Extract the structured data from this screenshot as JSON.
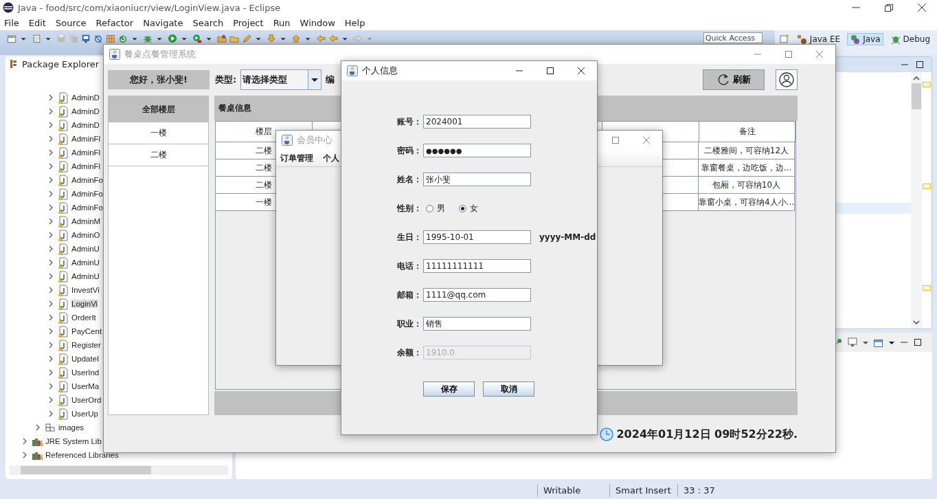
{
  "ide": {
    "title": "Java - food/src/com/xiaoniucr/view/LoginView.java - Eclipse",
    "menu": [
      "File",
      "Edit",
      "Source",
      "Refactor",
      "Navigate",
      "Search",
      "Project",
      "Run",
      "Window",
      "Help"
    ],
    "quick_access": {
      "placeholder": "Quick Access"
    },
    "perspectives": [
      {
        "label": "Java EE",
        "selected": false
      },
      {
        "label": "Java",
        "selected": true
      },
      {
        "label": "Debug",
        "selected": false
      }
    ],
    "package_explorer": {
      "title": "Package Explorer",
      "tree": [
        {
          "kind": "group",
          "children": [
            {
              "kind": "group",
              "children": [
                {
                  "label": "AdminD",
                  "kind": "file",
                  "expanded": false,
                  "selected": false
                },
                {
                  "label": "AdminD",
                  "kind": "file",
                  "expanded": false,
                  "selected": false
                },
                {
                  "label": "AdminD",
                  "kind": "file",
                  "expanded": false,
                  "selected": false
                },
                {
                  "label": "AdminFl",
                  "kind": "file",
                  "expanded": false,
                  "selected": false
                },
                {
                  "label": "AdminFl",
                  "kind": "file",
                  "expanded": false,
                  "selected": false
                },
                {
                  "label": "AdminFl",
                  "kind": "file",
                  "expanded": false,
                  "selected": false
                },
                {
                  "label": "AdminFo",
                  "kind": "file",
                  "expanded": false,
                  "selected": false
                },
                {
                  "label": "AdminFo",
                  "kind": "file",
                  "expanded": false,
                  "selected": false
                },
                {
                  "label": "AdminFo",
                  "kind": "file",
                  "expanded": false,
                  "selected": false
                },
                {
                  "label": "AdminM",
                  "kind": "file",
                  "expanded": false,
                  "selected": false
                },
                {
                  "label": "AdminO",
                  "kind": "file",
                  "expanded": false,
                  "selected": false
                },
                {
                  "label": "AdminU",
                  "kind": "file",
                  "expanded": false,
                  "selected": false
                },
                {
                  "label": "AdminU",
                  "kind": "file",
                  "expanded": false,
                  "selected": false
                },
                {
                  "label": "AdminU",
                  "kind": "file",
                  "expanded": false,
                  "selected": false
                },
                {
                  "label": "InvestVi",
                  "kind": "file",
                  "expanded": false,
                  "selected": false
                },
                {
                  "label": "LoginVi",
                  "kind": "file",
                  "expanded": false,
                  "selected": true
                },
                {
                  "label": "OrderIt",
                  "kind": "file",
                  "expanded": false,
                  "selected": false
                },
                {
                  "label": "PayCent",
                  "kind": "file",
                  "expanded": false,
                  "selected": false
                },
                {
                  "label": "Register",
                  "kind": "file",
                  "expanded": false,
                  "selected": false
                },
                {
                  "label": "UpdateI",
                  "kind": "file",
                  "expanded": false,
                  "selected": false
                },
                {
                  "label": "UserInd",
                  "kind": "file",
                  "expanded": false,
                  "selected": false
                },
                {
                  "label": "UserMa",
                  "kind": "file",
                  "expanded": false,
                  "selected": false
                },
                {
                  "label": "UserOrd",
                  "kind": "file",
                  "expanded": false,
                  "selected": false
                },
                {
                  "label": "UserUp",
                  "kind": "file",
                  "expanded": false,
                  "selected": false
                }
              ]
            },
            {
              "label": "images",
              "kind": "package",
              "expanded": false,
              "selected": false
            }
          ]
        },
        {
          "label": "JRE System Lib",
          "kind": "library",
          "expanded": false,
          "selected": false
        },
        {
          "label": "Referenced Libraries",
          "kind": "library",
          "expanded": false,
          "selected": false
        }
      ]
    },
    "status_bar": [
      "Writable",
      "Smart Insert",
      "33 : 37"
    ]
  },
  "app_window": {
    "title": "餐桌点餐管理系统",
    "active": false,
    "greeting": "您好，张小斐!",
    "type_label": "类型:",
    "type_combo": "请选择类型",
    "number_label": "编",
    "refresh_button": "刷新",
    "floors": {
      "header": "全部楼层",
      "items": [
        {
          "label": "一楼",
          "selected": false
        },
        {
          "label": "二楼",
          "selected": false
        }
      ]
    },
    "table": {
      "title": "餐桌信息",
      "columns": [
        "楼层",
        "备注"
      ],
      "rows": [
        {
          "floor": "二楼",
          "note": "二楼雅间，可容纳12人"
        },
        {
          "floor": "二楼",
          "note": "靠窗餐桌，边吃饭，边..."
        },
        {
          "floor": "二楼",
          "note": "包厢，可容纳10人"
        },
        {
          "floor": "一楼",
          "note": "靠窗小桌，可容纳4人小..."
        }
      ]
    },
    "datetime": "2024年01月12日 09时52分22秒."
  },
  "member_window": {
    "title": "会员中心",
    "active": false,
    "menu": [
      "订单管理",
      "个人"
    ]
  },
  "info_dialog": {
    "title": "个人信息",
    "active": true,
    "fields": [
      {
        "label": "账号：",
        "kind": "text",
        "value": "2024001",
        "disabled": false
      },
      {
        "label": "密码：",
        "kind": "password",
        "value": "●●●●●●",
        "disabled": false
      },
      {
        "label": "姓名：",
        "kind": "text",
        "value": "张小斐",
        "disabled": false
      },
      {
        "label": "性别：",
        "kind": "radio",
        "options": [
          {
            "label": "男",
            "selected": false
          },
          {
            "label": "女",
            "selected": true
          }
        ]
      },
      {
        "label": "生日：",
        "kind": "text",
        "value": "1995-10-01",
        "disabled": false,
        "note": "yyyy-MM-dd"
      },
      {
        "label": "电话：",
        "kind": "text",
        "value": "11111111111",
        "disabled": false
      },
      {
        "label": "邮箱：",
        "kind": "text",
        "value": "1111@qq.com",
        "disabled": false
      },
      {
        "label": "职业：",
        "kind": "text",
        "value": "销售",
        "disabled": false
      },
      {
        "label": "余额：",
        "kind": "text",
        "value": "1910.0",
        "disabled": true
      }
    ],
    "buttons": [
      "保存",
      "取消"
    ]
  }
}
